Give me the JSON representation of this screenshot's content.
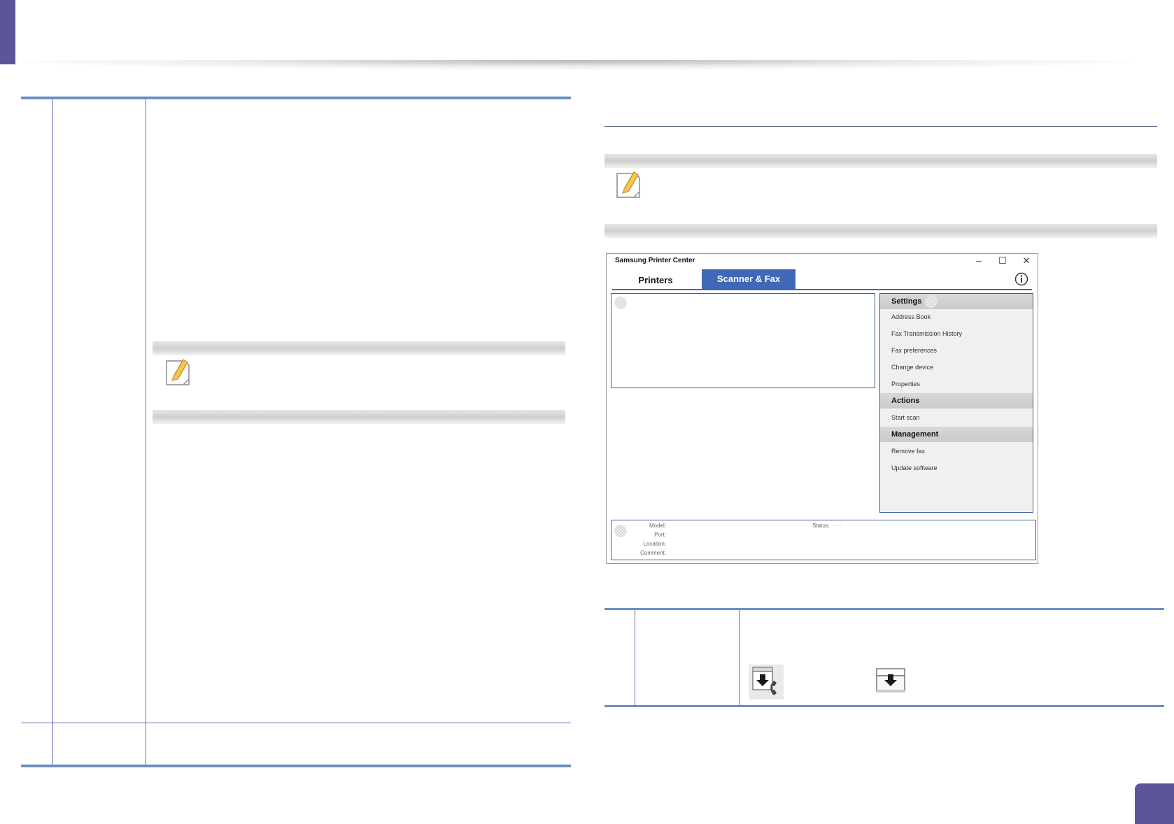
{
  "colors": {
    "accent": "#5b559c",
    "table_rule": "#6b8fc0",
    "tab_active": "#3f68b9",
    "panel_border": "#3a5d9e"
  },
  "window": {
    "title": "Samsung Printer Center",
    "controls": [
      "minimize-icon",
      "maximize-icon",
      "close-icon"
    ],
    "tabs": [
      {
        "label": "Printers",
        "active": false
      },
      {
        "label": "Scanner & Fax",
        "active": true
      }
    ],
    "side_panel": {
      "sections": [
        {
          "header": "Settings",
          "items": [
            "Address Book",
            "Fax Transmission History",
            "Fax preferences",
            "Change device",
            "Properties"
          ]
        },
        {
          "header": "Actions",
          "items": [
            "Start scan"
          ]
        },
        {
          "header": "Management",
          "items": [
            "Remove fax",
            "Update software"
          ]
        }
      ]
    },
    "info_panel": {
      "labels": [
        "Model:",
        "Port:",
        "Location:",
        "Comment:"
      ],
      "status_label": "Status:",
      "status_value": "· · ·"
    }
  },
  "icons": {
    "note": "note-pencil-icon",
    "fax_download": "fax-download-icon",
    "scan_download": "scan-download-icon"
  }
}
